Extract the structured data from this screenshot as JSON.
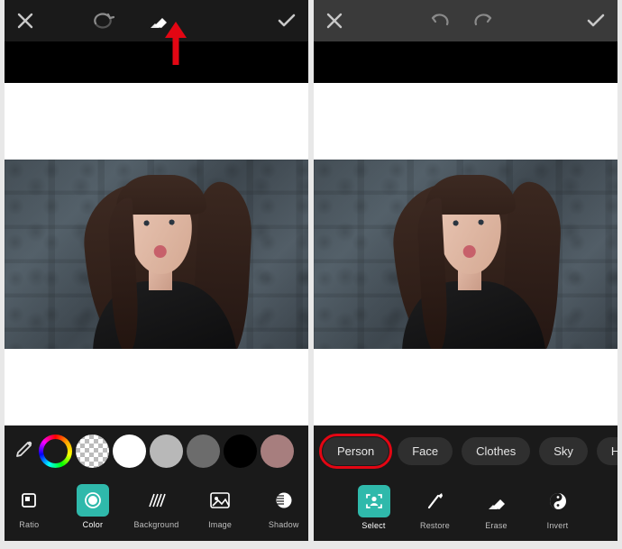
{
  "left": {
    "topbar": {
      "close": "×",
      "compare_icon": "compare",
      "eraser_icon": "eraser",
      "confirm": "✓"
    },
    "swatches": {
      "colors": [
        "#ffffff",
        "#b8b8b8",
        "#6c6c6c",
        "#000000",
        "#a77e7e"
      ]
    },
    "tools": {
      "ratio": "Ratio",
      "color": "Color",
      "background": "Background",
      "image": "Image",
      "shadow": "Shadow"
    },
    "active_tool": "color"
  },
  "right": {
    "topbar": {
      "close": "×",
      "undo": "undo",
      "redo": "redo",
      "confirm": "✓"
    },
    "chips": {
      "person": "Person",
      "face": "Face",
      "clothes": "Clothes",
      "sky": "Sky",
      "more": "He"
    },
    "tools": {
      "select": "Select",
      "restore": "Restore",
      "erase": "Erase",
      "invert": "Invert"
    },
    "active_tool": "select",
    "selected_chip": "person"
  }
}
